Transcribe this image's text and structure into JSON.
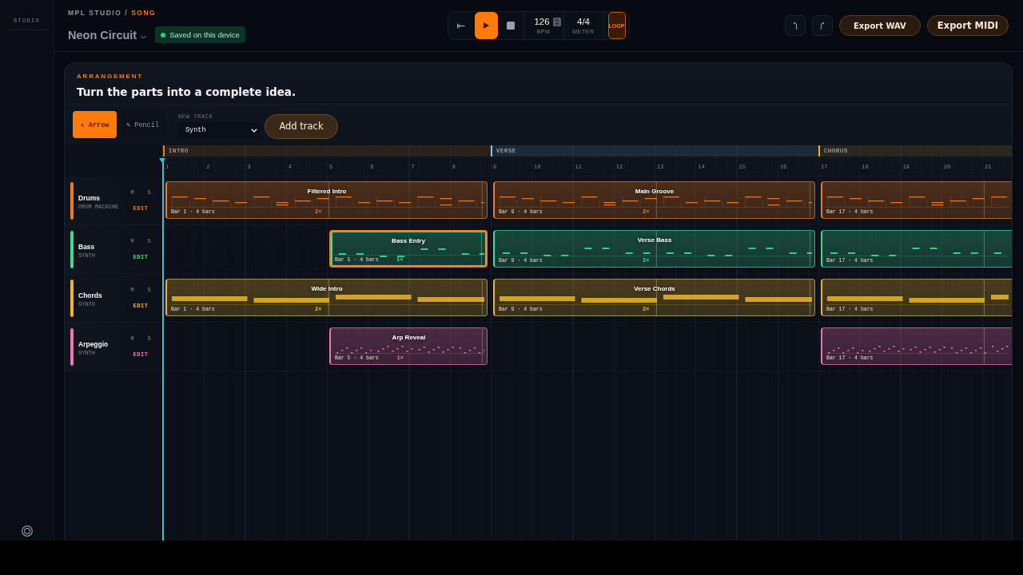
{
  "sidebar": {
    "label": "STUDIO"
  },
  "header": {
    "breadcrumb": [
      {
        "text": "MPL STUDIO",
        "current": false
      },
      {
        "text": "SONG",
        "current": true
      }
    ],
    "separator": "/",
    "title": "Neon Circuit",
    "save_status": "Saved on this device"
  },
  "transport": {
    "bpm": "126",
    "bpm_label": "BPM",
    "meter": "4/4",
    "meter_label": "METER",
    "loop": {
      "label": "LOOP",
      "on": true
    }
  },
  "actions": [
    "Export WAV",
    "Export MIDI"
  ],
  "arrangement": {
    "eyebrow": "ARRANGEMENT",
    "heading": "Turn the parts into a complete idea.",
    "tools": [
      {
        "label": "↖ Arrow",
        "selected": true
      },
      {
        "label": "✎ Pencil",
        "selected": false
      }
    ],
    "new_track": {
      "label": "NEW TRACK",
      "value": "Synth"
    },
    "add_button": "Add track",
    "sections": [
      {
        "label": "INTRO",
        "color": "#f07a1a"
      },
      {
        "label": "VERSE",
        "color": "#8cc4e0"
      },
      {
        "label": "CHORUS",
        "color": "#e8b230"
      }
    ],
    "ruler": [
      "1",
      "2",
      "3",
      "4",
      "5",
      "6",
      "7",
      "8",
      "9",
      "10",
      "11",
      "12",
      "13",
      "14",
      "15",
      "16",
      "17",
      "18",
      "19",
      "20",
      "21"
    ],
    "tracks": [
      {
        "name": "Drums",
        "type": "DRUM MACHINE",
        "kind": "drums",
        "color": "#f5781e",
        "mute_label": "M",
        "solo_label": "S",
        "edit_label": "EDIT",
        "muted": false,
        "soloed": false,
        "clips": [
          {
            "title": "Filtered Intro",
            "label": "Bar 1 · 4 bars",
            "repeat": "2×",
            "selected": false
          },
          {
            "title": "Main Groove",
            "label": "Bar 9 · 4 bars",
            "repeat": "2×",
            "selected": false
          },
          {
            "label": "Bar 17 · 4 bars",
            "selected": false
          }
        ]
      },
      {
        "name": "Bass",
        "type": "SYNTH",
        "kind": "bass",
        "color": "#3ddc97",
        "mute_label": "M",
        "solo_label": "S",
        "edit_label": "EDIT",
        "muted": false,
        "soloed": false,
        "clips": [
          {
            "title": "Bass Entry",
            "label": "Bar 5 · 4 bars",
            "repeat": "1×",
            "selected": true
          },
          {
            "title": "Verse Bass",
            "label": "Bar 9 · 4 bars",
            "repeat": "2×",
            "selected": false
          },
          {
            "label": "Bar 17 · 4 bars",
            "selected": false
          }
        ]
      },
      {
        "name": "Chords",
        "type": "SYNTH",
        "kind": "chords",
        "color": "#f0b429",
        "mute_label": "M",
        "solo_label": "S",
        "edit_label": "EDIT",
        "muted": false,
        "soloed": false,
        "clips": [
          {
            "title": "Wide Intro",
            "label": "Bar 1 · 4 bars",
            "repeat": "2×",
            "selected": false
          },
          {
            "title": "Verse Chords",
            "label": "Bar 9 · 4 bars",
            "repeat": "2×",
            "selected": false
          },
          {
            "label": "Bar 17 · 4 bars",
            "selected": false
          }
        ]
      },
      {
        "name": "Arpeggio",
        "type": "SYNTH",
        "kind": "arp",
        "color": "#f472b6",
        "mute_label": "M",
        "solo_label": "S",
        "edit_label": "EDIT",
        "muted": false,
        "soloed": false,
        "clips": [
          {
            "title": "Arp Reveal",
            "label": "Bar 5 · 4 bars",
            "repeat": "1×",
            "selected": false
          },
          {
            "label": "Bar 17 · 4 bars",
            "selected": false
          }
        ]
      }
    ]
  }
}
